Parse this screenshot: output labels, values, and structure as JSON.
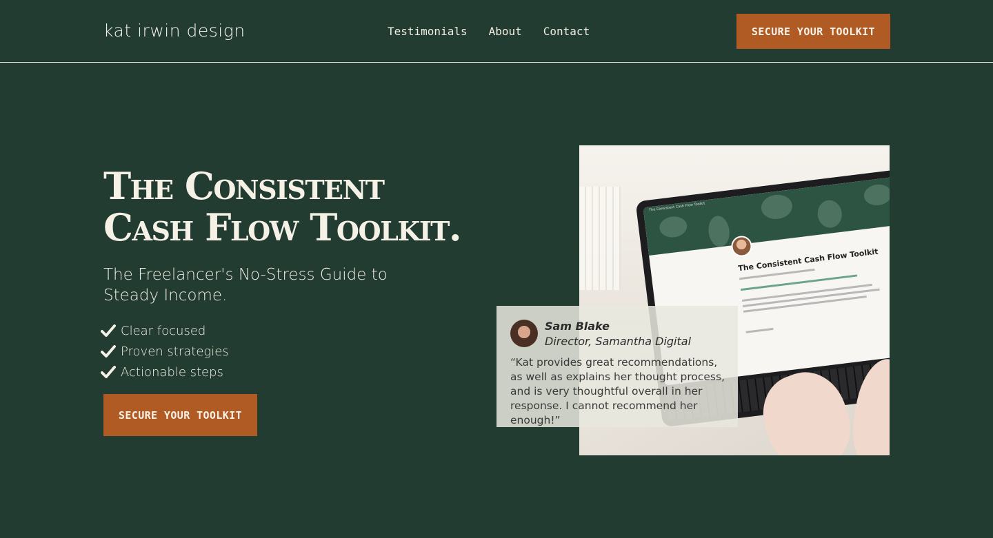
{
  "header": {
    "logo": "kat irwin design",
    "nav": [
      "Testimonials",
      "About",
      "Contact"
    ],
    "cta_label": "SECURE YOUR TOOLKIT"
  },
  "hero": {
    "title_line1": "The Consistent",
    "title_line2": "Cash Flow Toolkit.",
    "subtitle": "The Freelancer's No-Stress Guide to Steady Income.",
    "features": [
      "Clear focused",
      "Proven strategies",
      "Actionable steps"
    ],
    "cta_label": "SECURE YOUR TOOLKIT"
  },
  "mockup": {
    "tab_title": "The Consistent Cash Flow Toolkit",
    "heading": "The Consistent Cash Flow Toolkit"
  },
  "testimonial": {
    "name": "Sam Blake",
    "role": "Director, Samantha Digital",
    "quote": "“Kat provides great recommendations, as well as explains her thought process, and is very thoughtful overall in her response. I cannot recommend her enough!”"
  },
  "colors": {
    "background": "#233c31",
    "accent": "#b05a24",
    "text": "#f2eee4"
  }
}
